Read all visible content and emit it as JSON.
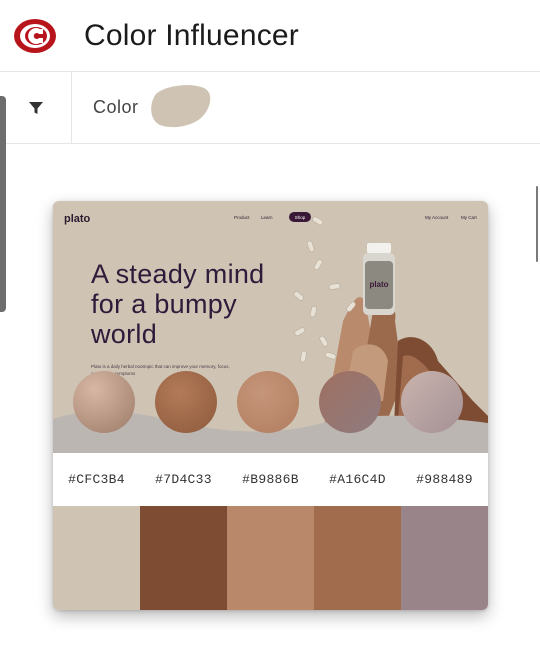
{
  "app": {
    "title": "Color Influencer",
    "logo_icon": "red-c-logo-icon"
  },
  "toolbar": {
    "filter_icon": "filter-icon",
    "color_label": "Color",
    "selected_color": "#cfc3b4"
  },
  "preview": {
    "site_logo": "plato",
    "nav_items": [
      "Product",
      "Learn",
      "Shop",
      "My Account",
      "My Cart"
    ],
    "headline": "A steady mind for a bumpy world",
    "blurb": "Plato is a daily herbal nootropic that can improve your memory, focus, and reduce symptoms"
  },
  "palette": [
    {
      "hex": "#CFC3B4",
      "color": "#cfc3b4"
    },
    {
      "hex": "#7D4C33",
      "color": "#7d4c33"
    },
    {
      "hex": "#B9886B",
      "color": "#b9886b"
    },
    {
      "hex": "#A16C4D",
      "color": "#a16c4d"
    },
    {
      "hex": "#988489",
      "color": "#988489"
    }
  ]
}
